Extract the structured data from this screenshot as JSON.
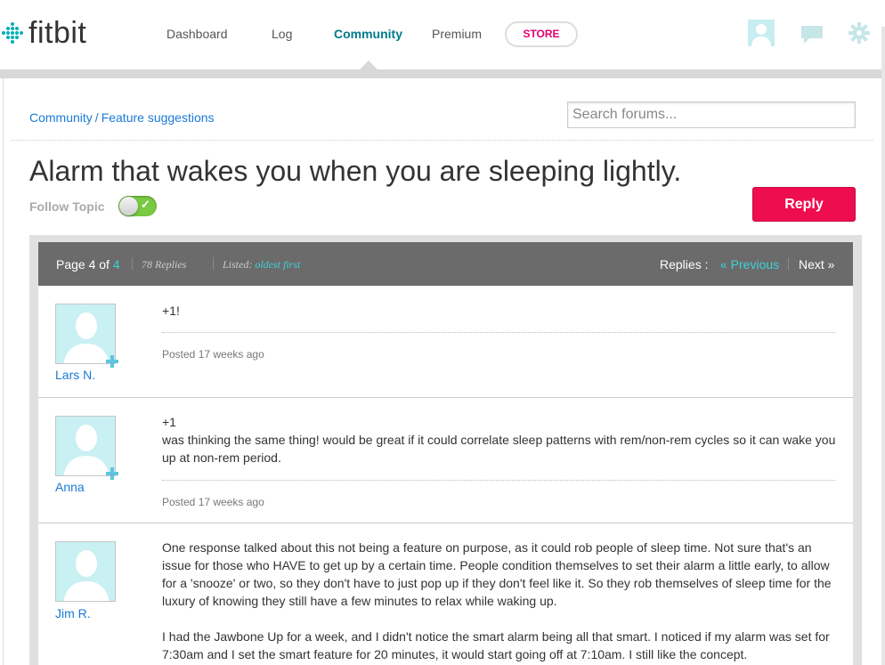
{
  "header": {
    "logo_text": "fitbit",
    "nav": [
      {
        "label": "Dashboard"
      },
      {
        "label": "Log"
      },
      {
        "label": "Community",
        "active": true
      },
      {
        "label": "Premium"
      }
    ],
    "store_label": "STORE",
    "accent_color": "#00b0b9"
  },
  "breadcrumb": {
    "root": "Community",
    "separator": "/",
    "section": "Feature suggestions"
  },
  "search": {
    "placeholder": "Search forums..."
  },
  "topic": {
    "title": "Alarm that wakes you when you are sleeping lightly.",
    "follow_label": "Follow Topic",
    "follow_on": true,
    "reply_label": "Reply"
  },
  "pager": {
    "page_label": "Page 4 of",
    "total_pages": "4",
    "replies_count": "78 Replies",
    "listed_label": "Listed:",
    "listed_order": "oldest first",
    "replies_label": "Replies :",
    "prev_label": "« Previous",
    "next_label": "Next »"
  },
  "posts": [
    {
      "author": "Lars N.",
      "lines": [
        "+1!"
      ],
      "posted": "Posted 17 weeks ago"
    },
    {
      "author": "Anna",
      "lines": [
        "+1",
        "was thinking the same thing! would be great if it could correlate sleep patterns with rem/non-rem cycles so it can wake you up at non-rem period."
      ],
      "posted": "Posted 17 weeks ago"
    },
    {
      "author": "Jim R.",
      "paragraphs": [
        "One response talked about this not being a feature on purpose, as it could rob people of sleep time. Not sure that's an issue for those who HAVE to get up by a certain time. People condition themselves to set their alarm a little early, to allow for a 'snooze' or two, so they don't have to just pop up if they don't feel like it. So they rob themselves of sleep time for the luxury of knowing they still have a few minutes to relax while waking up.",
        "I had the Jawbone Up for a week, and I didn't notice the smart alarm being all that smart. I noticed if my alarm was set for 7:30am and I set the smart feature for 20 minutes, it would start going off at 7:10am. I still like the concept."
      ]
    }
  ]
}
